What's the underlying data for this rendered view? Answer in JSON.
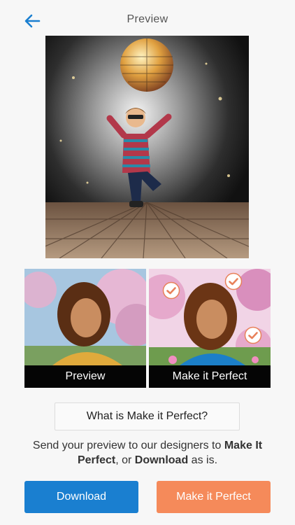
{
  "header": {
    "title": "Preview",
    "back_icon": "arrow-left-icon",
    "accent": "#1a7fd0"
  },
  "thumbnails": [
    {
      "label": "Preview"
    },
    {
      "label": "Make it Perfect",
      "badge_icon": "check-circle-icon"
    }
  ],
  "info_button": {
    "label": "What is Make it Perfect?"
  },
  "description": {
    "part1": "Send your preview to our designers to ",
    "bold1": "Make It Perfect",
    "part2": ", or ",
    "bold2": "Download",
    "part3": " as is."
  },
  "actions": {
    "download_label": "Download",
    "download_color": "#1a7fd0",
    "perfect_label": "Make it Perfect",
    "perfect_color": "#f58a5a"
  }
}
